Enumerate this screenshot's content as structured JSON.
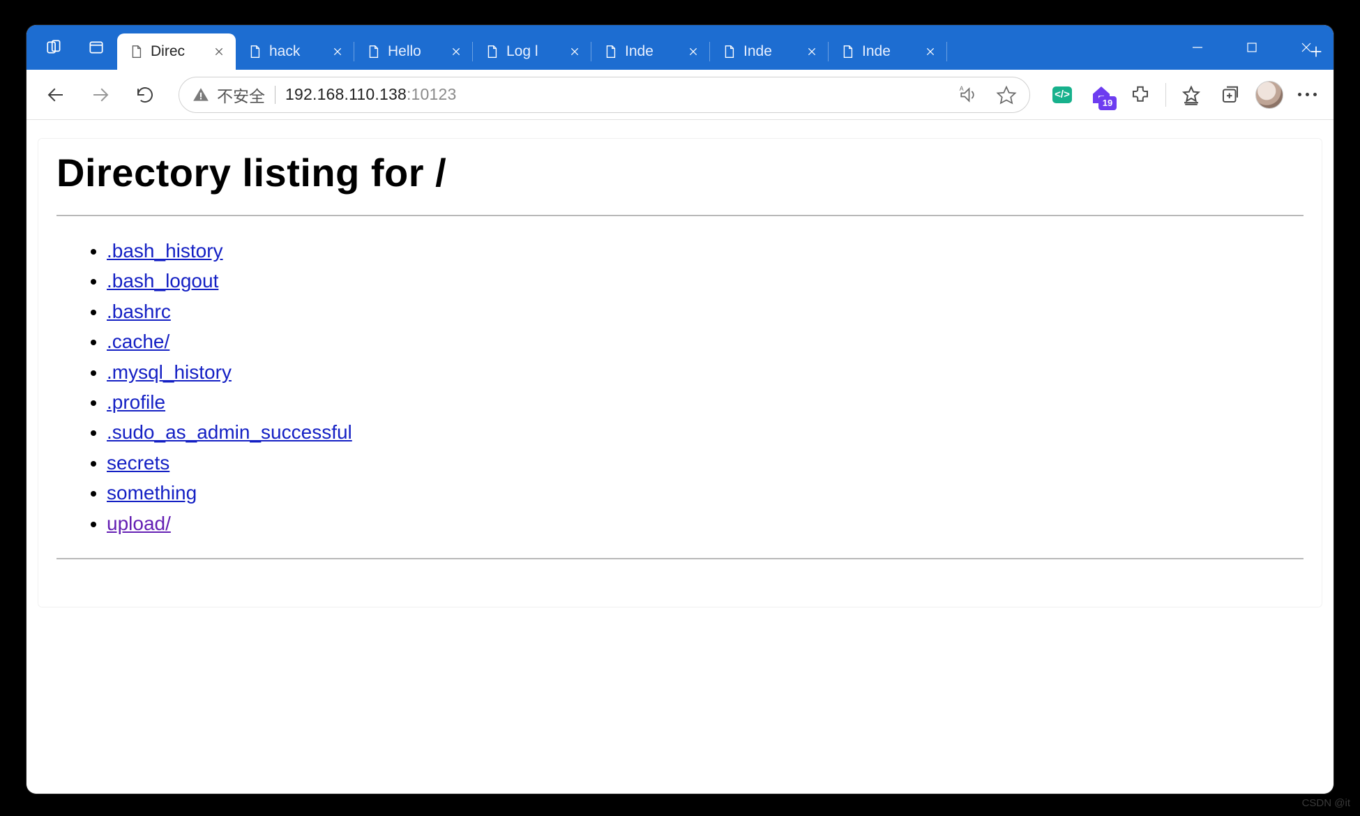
{
  "window": {
    "tabs": [
      {
        "label": "Direc",
        "active": true
      },
      {
        "label": "hack",
        "active": false
      },
      {
        "label": "Hello",
        "active": false
      },
      {
        "label": "Log l",
        "active": false
      },
      {
        "label": "Inde",
        "active": false
      },
      {
        "label": "Inde",
        "active": false
      },
      {
        "label": "Inde",
        "active": false
      }
    ]
  },
  "toolbar": {
    "not_secure_label": "不安全",
    "address_host": "192.168.110.138",
    "address_port": ":10123",
    "ext_badge": "19"
  },
  "page": {
    "title": "Directory listing for /",
    "files": [
      {
        "name": ".bash_history",
        "visited": false
      },
      {
        "name": ".bash_logout",
        "visited": false
      },
      {
        "name": ".bashrc",
        "visited": false
      },
      {
        "name": ".cache/",
        "visited": false
      },
      {
        "name": ".mysql_history",
        "visited": false
      },
      {
        "name": ".profile",
        "visited": false
      },
      {
        "name": ".sudo_as_admin_successful",
        "visited": false
      },
      {
        "name": "secrets",
        "visited": false
      },
      {
        "name": "something",
        "visited": false
      },
      {
        "name": "upload/",
        "visited": true
      }
    ]
  },
  "watermark": "CSDN @it"
}
